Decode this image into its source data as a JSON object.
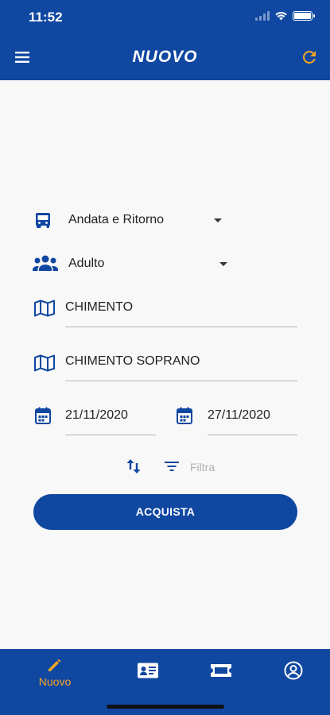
{
  "status_bar": {
    "time": "11:52"
  },
  "header": {
    "title": "NUOVO",
    "menu_icon": "menu-icon",
    "refresh_icon": "refresh-icon"
  },
  "form": {
    "trip_type": {
      "value": "Andata e Ritorno",
      "icon": "bus-icon"
    },
    "passenger_type": {
      "value": "Adulto",
      "icon": "group-icon"
    },
    "departure": {
      "value": "CHIMENTO",
      "icon": "map-icon"
    },
    "arrival": {
      "value": "CHIMENTO SOPRANO",
      "icon": "map-icon"
    },
    "departure_date": {
      "value": "21/11/2020",
      "icon": "calendar-icon"
    },
    "return_date": {
      "value": "27/11/2020",
      "icon": "calendar-icon"
    },
    "swap_icon": "swap-icon",
    "filter": {
      "label": "Filtra",
      "icon": "filter-icon"
    },
    "buy_label": "ACQUISTA"
  },
  "bottom_nav": {
    "items": [
      {
        "label": "Nuovo",
        "icon": "pencil-icon",
        "active": true
      },
      {
        "label": "",
        "icon": "id-card-icon"
      },
      {
        "label": "",
        "icon": "ticket-icon"
      },
      {
        "label": "",
        "icon": "account-icon"
      }
    ]
  },
  "colors": {
    "primary": "#0f47a1",
    "accent": "#f5a623",
    "background": "#f8f8f8"
  }
}
